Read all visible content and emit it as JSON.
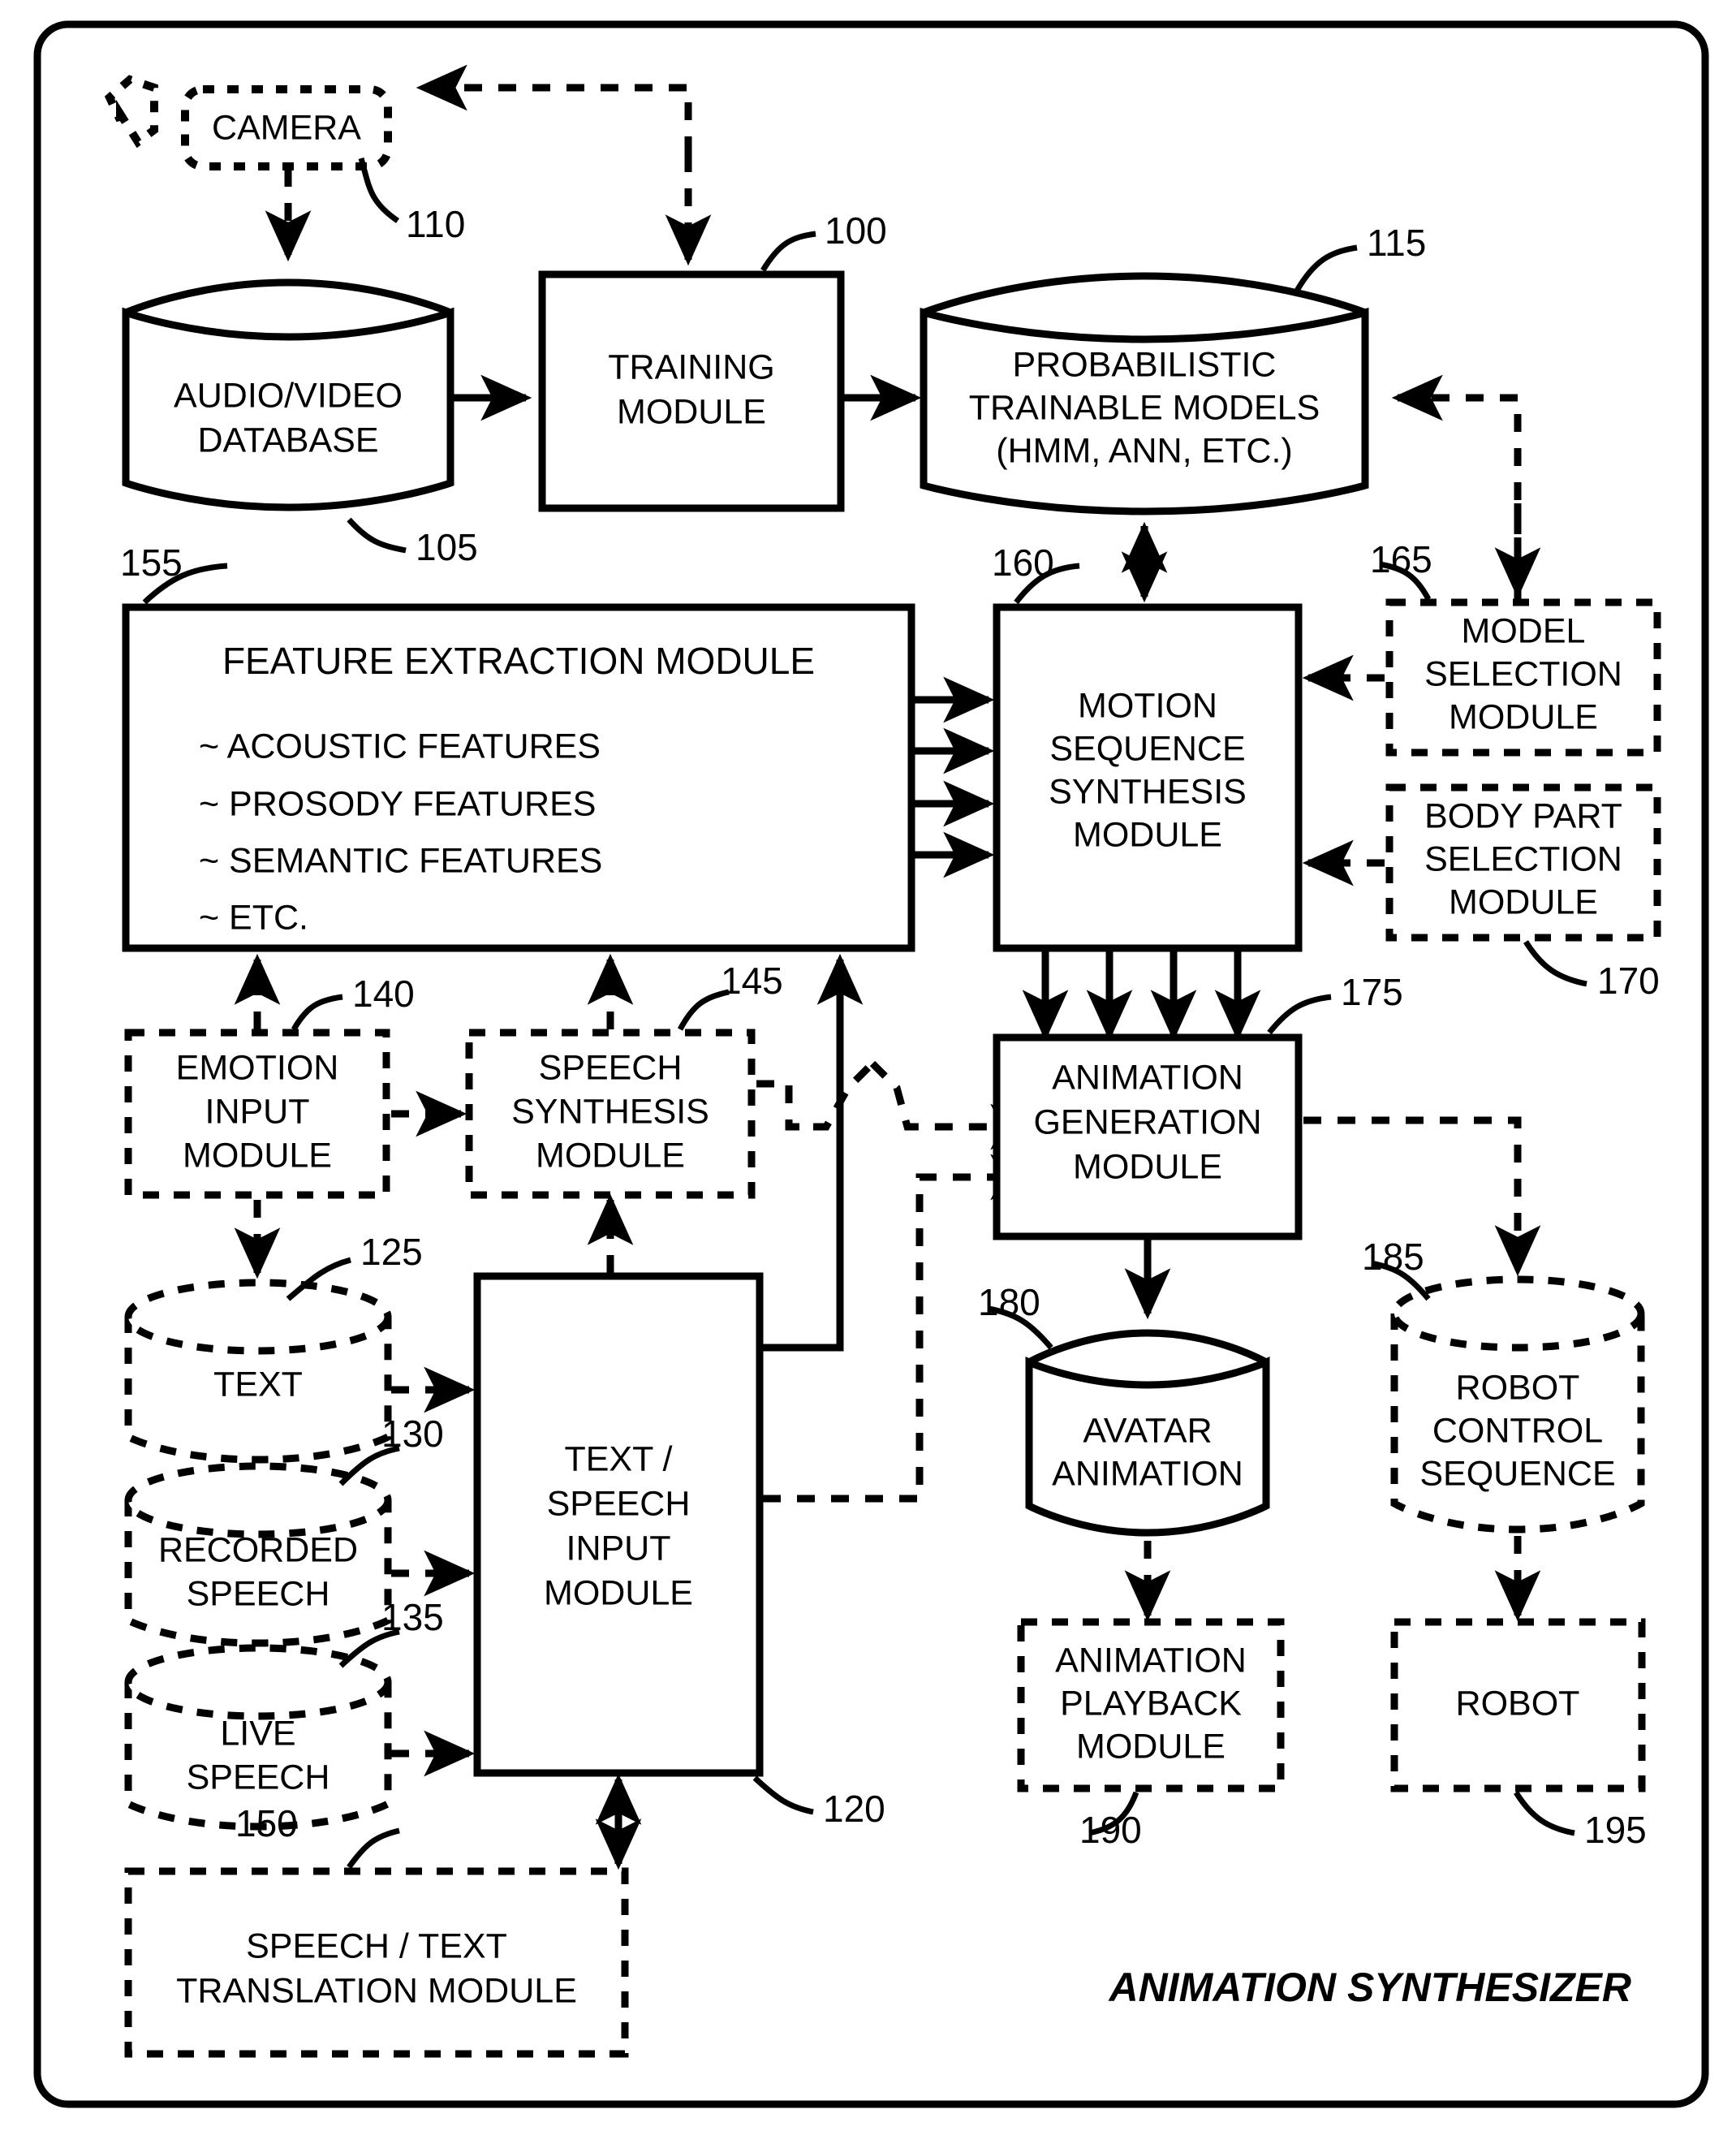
{
  "figure": {
    "title": "ANIMATION SYNTHESIZER",
    "frame": "rounded-rectangle-border"
  },
  "blocks": {
    "camera": {
      "ref": "110",
      "lines": [
        "CAMERA"
      ],
      "style": "dashed-rounded"
    },
    "audio_video_db": {
      "ref": "105",
      "lines": [
        "AUDIO/VIDEO",
        "DATABASE"
      ],
      "style": "solid-cylinder"
    },
    "training_module": {
      "ref": "100",
      "lines": [
        "TRAINING",
        "MODULE"
      ],
      "style": "solid-rect"
    },
    "probabilistic": {
      "ref": "115",
      "lines": [
        "PROBABILISTIC",
        "TRAINABLE MODELS",
        "(HMM, ANN, ETC.)"
      ],
      "style": "solid-cylinder"
    },
    "feature_extraction": {
      "ref": "155",
      "heading": "FEATURE EXTRACTION MODULE",
      "bullets": [
        "~ ACOUSTIC FEATURES",
        "~ PROSODY FEATURES",
        "~ SEMANTIC FEATURES",
        "~ ETC."
      ],
      "style": "solid-rect"
    },
    "motion_sequence": {
      "ref": "160",
      "lines": [
        "MOTION",
        "SEQUENCE",
        "SYNTHESIS",
        "MODULE"
      ],
      "style": "solid-rect"
    },
    "model_selection": {
      "ref": "165",
      "lines": [
        "MODEL",
        "SELECTION",
        "MODULE"
      ],
      "style": "dashed-rect"
    },
    "body_part_selection": {
      "ref": "170",
      "lines": [
        "BODY PART",
        "SELECTION",
        "MODULE"
      ],
      "style": "dashed-rect"
    },
    "emotion_input": {
      "ref": "140",
      "lines": [
        "EMOTION",
        "INPUT",
        "MODULE"
      ],
      "style": "dashed-rect"
    },
    "speech_synthesis": {
      "ref": "145",
      "lines": [
        "SPEECH",
        "SYNTHESIS",
        "MODULE"
      ],
      "style": "dashed-rect"
    },
    "text_store": {
      "ref": "125",
      "lines": [
        "TEXT"
      ],
      "style": "dashed-cylinder"
    },
    "recorded_speech": {
      "ref": "130",
      "lines": [
        "RECORDED",
        "SPEECH"
      ],
      "style": "dashed-cylinder"
    },
    "live_speech": {
      "ref": "135",
      "lines": [
        "LIVE",
        "SPEECH"
      ],
      "style": "dashed-cylinder"
    },
    "text_speech_input": {
      "ref": "120",
      "lines": [
        "TEXT /",
        "SPEECH",
        "INPUT",
        "MODULE"
      ],
      "style": "solid-rect"
    },
    "translation": {
      "ref": "150",
      "lines": [
        "SPEECH / TEXT",
        "TRANSLATION MODULE"
      ],
      "style": "dashed-rect"
    },
    "animation_generation": {
      "ref": "175",
      "lines": [
        "ANIMATION",
        "GENERATION",
        "MODULE"
      ],
      "style": "solid-rect"
    },
    "avatar_animation": {
      "ref": "180",
      "lines": [
        "AVATAR",
        "ANIMATION"
      ],
      "style": "solid-cylinder"
    },
    "robot_control": {
      "ref": "185",
      "lines": [
        "ROBOT",
        "CONTROL",
        "SEQUENCE"
      ],
      "style": "dashed-cylinder"
    },
    "animation_playback": {
      "ref": "190",
      "lines": [
        "ANIMATION",
        "PLAYBACK",
        "MODULE"
      ],
      "style": "dashed-rect"
    },
    "robot": {
      "ref": "195",
      "lines": [
        "ROBOT"
      ],
      "style": "dashed-rect"
    }
  },
  "reference_numerals": [
    "100",
    "105",
    "110",
    "115",
    "120",
    "125",
    "130",
    "135",
    "140",
    "145",
    "150",
    "155",
    "160",
    "165",
    "170",
    "175",
    "180",
    "185",
    "190",
    "195"
  ],
  "colors": {
    "ink": "#000000",
    "paper": "#ffffff"
  }
}
